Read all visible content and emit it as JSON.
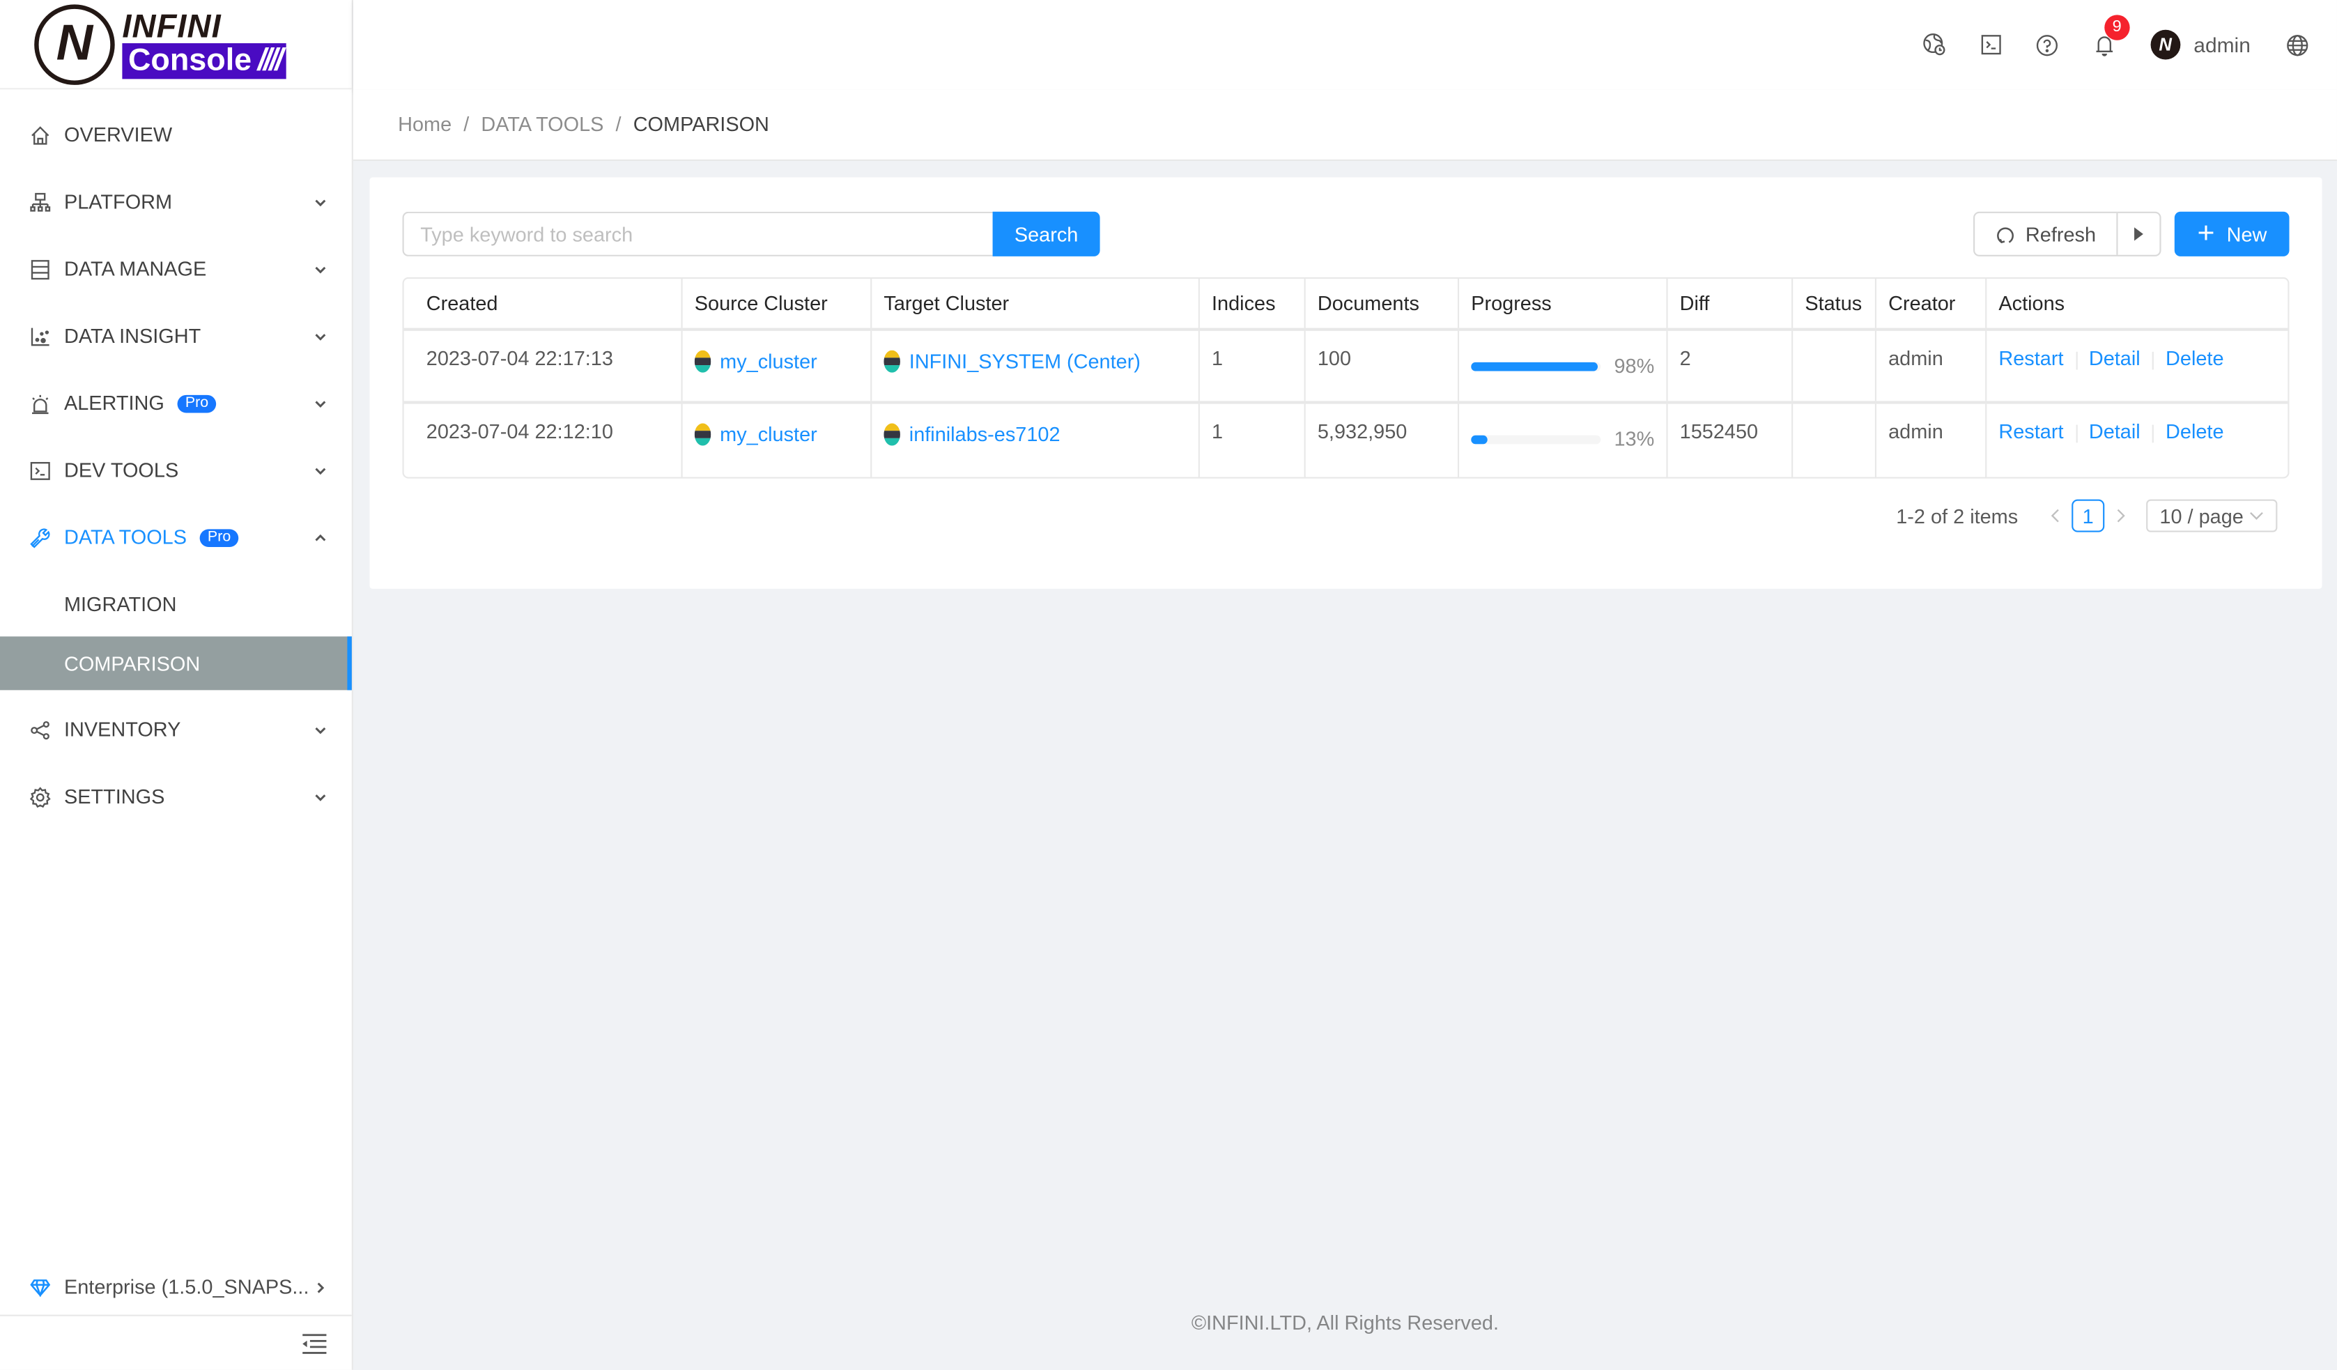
{
  "app": {
    "logo_top": "INFINI",
    "logo_bottom": "Console",
    "logo_bars": "////"
  },
  "header": {
    "icons": [
      "globe-clock-icon",
      "terminal-icon",
      "help-icon",
      "bell-icon",
      "language-icon"
    ],
    "notification_count": "9",
    "user_name": "admin"
  },
  "sidebar": {
    "items": [
      {
        "label": "OVERVIEW",
        "icon": "home-icon"
      },
      {
        "label": "PLATFORM",
        "icon": "cluster-icon"
      },
      {
        "label": "DATA MANAGE",
        "icon": "database-icon"
      },
      {
        "label": "DATA INSIGHT",
        "icon": "chart-icon"
      },
      {
        "label": "ALERTING",
        "icon": "alarm-icon",
        "badge": "Pro"
      },
      {
        "label": "DEV TOOLS",
        "icon": "terminal-icon"
      },
      {
        "label": "DATA TOOLS",
        "icon": "tool-icon",
        "badge": "Pro",
        "expanded": true
      },
      {
        "label": "INVENTORY",
        "icon": "share-icon"
      },
      {
        "label": "SETTINGS",
        "icon": "gear-icon"
      }
    ],
    "sub_items": [
      {
        "label": "MIGRATION"
      },
      {
        "label": "COMPARISON",
        "selected": true
      }
    ],
    "version": "Enterprise (1.5.0_SNAPS..."
  },
  "breadcrumb": [
    "Home",
    "DATA TOOLS",
    "COMPARISON"
  ],
  "toolbar": {
    "search_placeholder": "Type keyword to search",
    "search_value": "",
    "search_label": "Search",
    "refresh_label": "Refresh",
    "new_label": "New"
  },
  "table": {
    "columns": [
      "Created",
      "Source Cluster",
      "Target Cluster",
      "Indices",
      "Documents",
      "Progress",
      "Diff",
      "Status",
      "Creator",
      "Actions"
    ],
    "rows": [
      {
        "created": "2023-07-04 22:17:13",
        "source": "my_cluster",
        "target": "INFINI_SYSTEM (Center)",
        "indices": "1",
        "documents": "100",
        "progress": 98,
        "progress_label": "98%",
        "diff": "2",
        "status": "",
        "creator": "admin",
        "actions": [
          "Restart",
          "Detail",
          "Delete"
        ]
      },
      {
        "created": "2023-07-04 22:12:10",
        "source": "my_cluster",
        "target": "infinilabs-es7102",
        "indices": "1",
        "documents": "5,932,950",
        "progress": 13,
        "progress_label": "13%",
        "diff": "1552450",
        "status": "",
        "creator": "admin",
        "actions": [
          "Restart",
          "Detail",
          "Delete"
        ]
      }
    ]
  },
  "pagination": {
    "total_text": "1-2 of 2 items",
    "current_page": "1",
    "page_size": "10 / page"
  },
  "footer": "©INFINI.LTD, All Rights Reserved.",
  "colors": {
    "primary": "#1890ff",
    "danger": "#f5222d",
    "brand": "#4a0bc2",
    "selected_menu_bg": "#949fa0"
  }
}
